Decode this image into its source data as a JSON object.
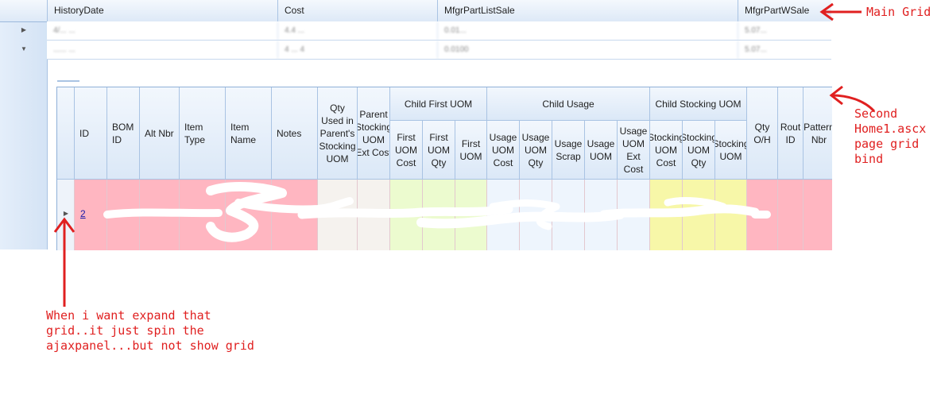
{
  "main_grid": {
    "columns": [
      "HistoryDate",
      "Cost",
      "MfgrPartListSale",
      "MfgrPartWSale"
    ],
    "rows": [
      {
        "expander": "collapsed",
        "cells": [
          "4/... ...",
          "4.4 ... ",
          "0.01... ",
          "5.07..."
        ]
      },
      {
        "expander": "expanded",
        "cells": [
          "...... ...",
          "4 ... 4",
          "0.0100 ",
          "5.07..."
        ]
      }
    ]
  },
  "child_grid": {
    "headers": {
      "id": "ID",
      "bom_id": "BOM ID",
      "alt_nbr": "Alt Nbr",
      "item_type": "Item Type",
      "item_name": "Item Name",
      "notes": "Notes",
      "qty_used": "Qty Used in Parent's Stocking UOM",
      "parent_stocking": "Parent Stocking UOM Ext Cost",
      "group_child_first_uom": "Child First UOM",
      "first_uom_cost": "First UOM Cost",
      "first_uom_qty": "First UOM Qty",
      "first_uom": "First UOM",
      "group_child_usage": "Child Usage",
      "usage_uom_cost": "Usage UOM Cost",
      "usage_uom_qty": "Usage UOM Qty",
      "usage_scrap": "Usage Scrap",
      "usage_uom": "Usage UOM",
      "usage_uom_ext_cost": "Usage UOM Ext Cost",
      "group_child_stocking_uom": "Child Stocking UOM",
      "stocking_uom_cost": "Stocking UOM Cost",
      "stocking_uom_qty": "Stocking UOM Qty",
      "stocking_uom": "Stocking UOM",
      "qty_oh": "Qty O/H",
      "rout_id": "Rout ID",
      "pattern_nbr": "Pattern Nbr"
    },
    "row": {
      "id_link": "2"
    }
  },
  "annotations": {
    "main_grid": "Main Grid",
    "second_grid": "Second\nHome1.ascx\npage grid\nbind",
    "note": "When i want expand that\ngrid..it just spin the\najaxpanel...but not show grid"
  },
  "colors": {
    "annotation_red": "#e02020",
    "row_pink": "#ffb6c1",
    "row_green": "#ecfbcf",
    "row_blue": "#eef5fd",
    "row_yellow": "#f7f7a8",
    "header_border": "#a9c3e3"
  }
}
